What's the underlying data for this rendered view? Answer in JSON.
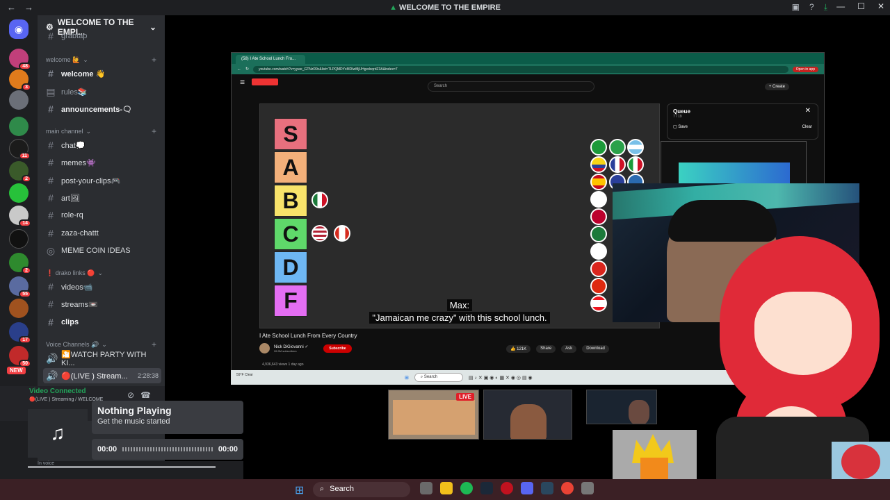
{
  "window": {
    "title": "WELCOME TO THE EMPIRE"
  },
  "guild": {
    "name": "WELCOME TO THE EMPI...",
    "partial_top": "grabtap"
  },
  "servers": [
    {
      "badge": "48",
      "color": "#c13f7a"
    },
    {
      "badge": "3",
      "color": "#e07b1c"
    },
    {
      "badge": "",
      "color": "#6b6f78"
    },
    {
      "badge": "",
      "color": "#2f8a4a"
    },
    {
      "badge": "11",
      "color": "#1b1b1b"
    },
    {
      "badge": "2",
      "color": "#3a5a2a"
    },
    {
      "badge": "",
      "color": "#27c13a"
    },
    {
      "badge": "14",
      "color": "#c9c9c9"
    },
    {
      "badge": "",
      "color": "#111111"
    },
    {
      "badge": "2",
      "color": "#2e8a2e"
    },
    {
      "badge": "55",
      "color": "#5a6ba0"
    },
    {
      "badge": "",
      "color": "#a0521f"
    },
    {
      "badge": "17",
      "color": "#2a3f8a"
    },
    {
      "badge": "50",
      "color": "#c12a2a"
    }
  ],
  "new_badge": "NEW",
  "categories": {
    "welcome": "welcome 🙋",
    "main": "main channel",
    "drako": "❗ drako links 🔴",
    "voice": "Voice Channels 🔊"
  },
  "channels": {
    "welcome": "welcome 👋",
    "rules": "rules📚",
    "announcements": "announcements-🗨",
    "chat": "chat💭",
    "memes": "memes👾",
    "post_your_clips": "post-your-clips🎮",
    "art": "art🖼",
    "role_rq": "role-rq",
    "zaza": "zaza-chattt",
    "meme_coin": "MEME COIN IDEAS",
    "videos": "videos📹",
    "streams": "streams📼",
    "clips": "clips",
    "watch_party": "🎦WATCH PARTY WITH KI...",
    "live_stream": "🔴(LIVE ) Stream...",
    "live_time": "2:28:38"
  },
  "voice_panel": {
    "status": "Video Connected",
    "sub": "🔴(LIVE ) Streaming / WELCOME",
    "in_voice": "In voice"
  },
  "music": {
    "title": "Nothing Playing",
    "subtitle": "Get the music started",
    "current": "00:00",
    "total": "00:00"
  },
  "browser": {
    "tab": "(58) I Ate School Lunch Fro...",
    "url": "youtube.com/watch?v=yywe_GTNzR9c&list=TLPQMDYxMDIwMjUHgxdxqrdZ3A&index=7",
    "open_in_app": "Open in app",
    "search": "Search",
    "create": "Create",
    "queue_title": "Queue",
    "queue_count": "7 / 19",
    "save": "Save",
    "clear": "Clear"
  },
  "video": {
    "tiers": [
      {
        "label": "S",
        "color": "#e8707e"
      },
      {
        "label": "A",
        "color": "#f3b07a"
      },
      {
        "label": "B",
        "color": "#f8e36a"
      },
      {
        "label": "C",
        "color": "#5fd86a"
      },
      {
        "label": "D",
        "color": "#6eb7f3"
      },
      {
        "label": "F",
        "color": "#e46ef3"
      }
    ],
    "caption_speaker": "Max:",
    "caption_line": "\"Jamaican me crazy\" with this school lunch.",
    "title": "I Ate School Lunch From Every Country",
    "channel": "Nick DiGiovanni ✓",
    "subscribers": "26.9M subscribers",
    "subscribe": "Subscribe",
    "likes": "👍 121K",
    "share": "Share",
    "ask": "Ask",
    "download": "Download",
    "views": "4,936,643 views  1 day ago"
  },
  "taskbar_inner": {
    "search": "Search",
    "weather": "59°F Clear"
  },
  "thumbnails": {
    "live": "LIVE"
  },
  "taskbar": {
    "search": "Search"
  }
}
